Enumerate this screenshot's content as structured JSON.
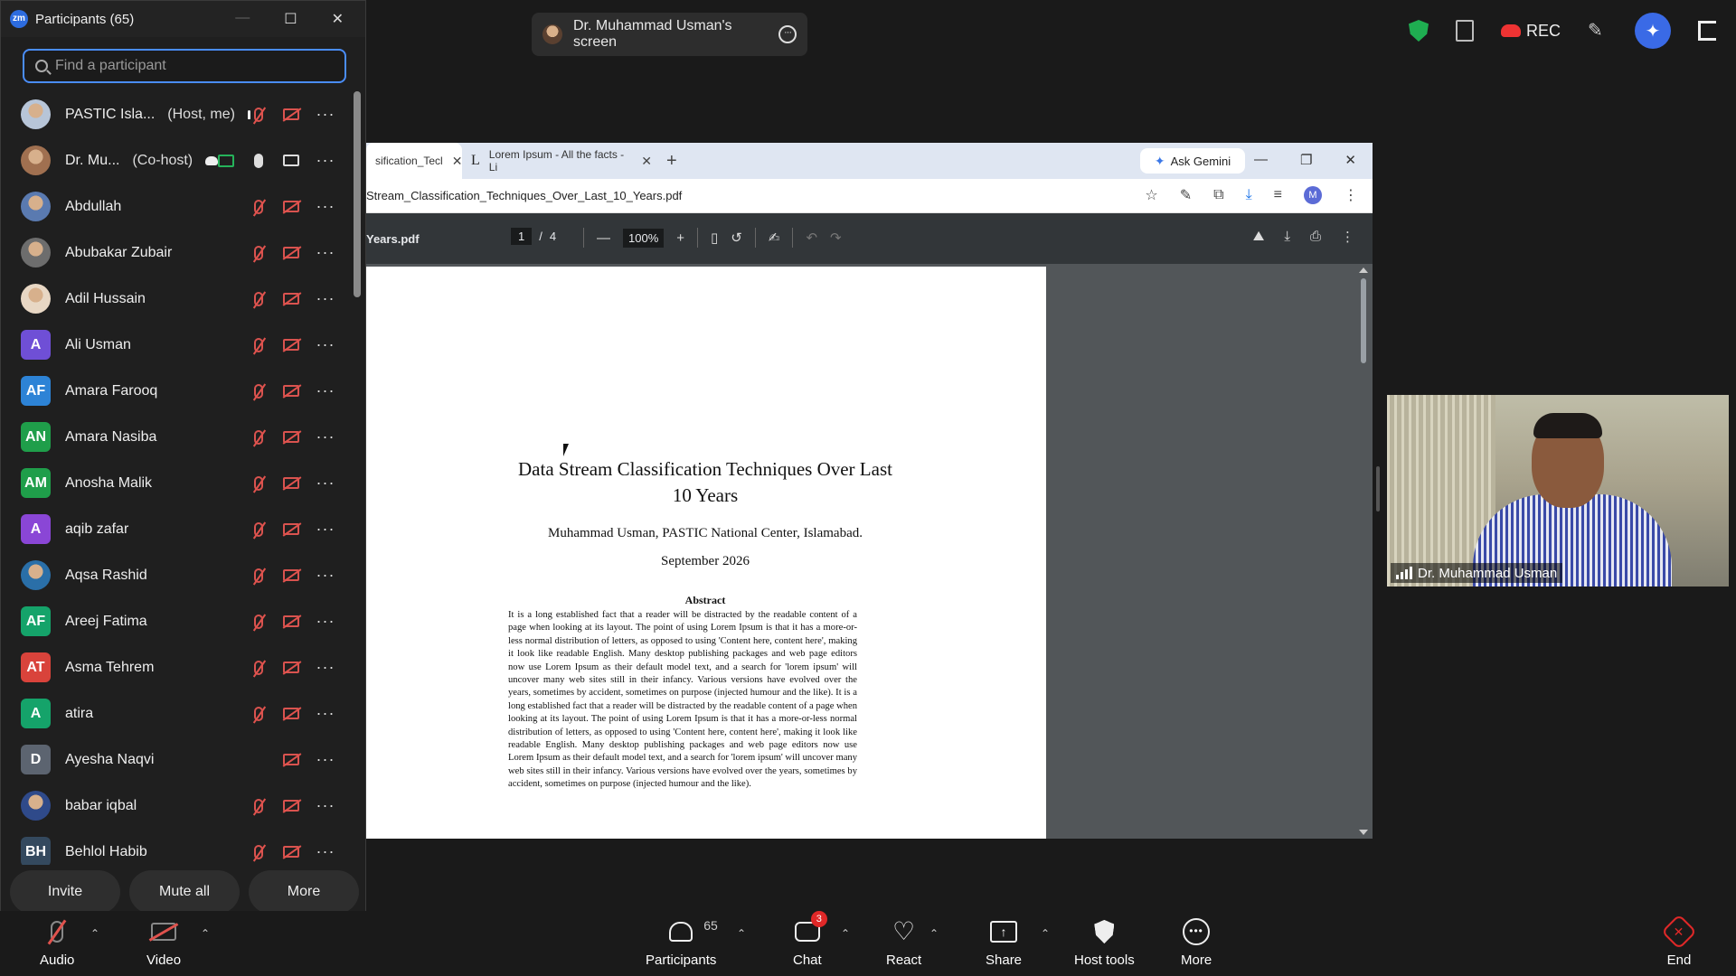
{
  "top_bar": {
    "screen_share_label": "Dr. Muhammad Usman's screen",
    "rec_label": "REC",
    "colors": {
      "security": "#1fae51",
      "rec": "#e33333",
      "ai": "#3a6ae6"
    }
  },
  "participants_panel": {
    "title": "Participants (65)",
    "search_placeholder": "Find a participant",
    "participants": [
      {
        "name": "PASTIC Isla...",
        "tag": "(Host, me)",
        "avatar_type": "photo",
        "avatar_color": "#b7c5d8",
        "initials": "",
        "mic": "off",
        "video": "off",
        "cloud": true,
        "share": false
      },
      {
        "name": "Dr. Mu...",
        "tag": "(Co-host)",
        "avatar_type": "photo",
        "avatar_color": "#a07050",
        "initials": "",
        "mic": "on",
        "video": "on",
        "cloud": true,
        "share": true
      },
      {
        "name": "Abdullah",
        "tag": "",
        "avatar_type": "photo",
        "avatar_color": "#5a7ab0",
        "initials": "",
        "mic": "off",
        "video": "off"
      },
      {
        "name": "Abubakar Zubair",
        "tag": "",
        "avatar_type": "photo",
        "avatar_color": "#6d6d6d",
        "initials": "",
        "mic": "off",
        "video": "off"
      },
      {
        "name": "Adil Hussain",
        "tag": "",
        "avatar_type": "photo",
        "avatar_color": "#e8d7c4",
        "initials": "",
        "mic": "off",
        "video": "off"
      },
      {
        "name": "Ali Usman",
        "tag": "",
        "avatar_type": "initials",
        "avatar_color": "#6f4fd6",
        "initials": "A",
        "mic": "off",
        "video": "off"
      },
      {
        "name": "Amara Farooq",
        "tag": "",
        "avatar_type": "initials",
        "avatar_color": "#2d83d6",
        "initials": "AF",
        "mic": "off",
        "video": "off"
      },
      {
        "name": "Amara Nasiba",
        "tag": "",
        "avatar_type": "initials",
        "avatar_color": "#1f9e4a",
        "initials": "AN",
        "mic": "off",
        "video": "off"
      },
      {
        "name": "Anosha Malik",
        "tag": "",
        "avatar_type": "initials",
        "avatar_color": "#1f9e4a",
        "initials": "AM",
        "mic": "off",
        "video": "off"
      },
      {
        "name": "aqib zafar",
        "tag": "",
        "avatar_type": "initials",
        "avatar_color": "#8a46d6",
        "initials": "A",
        "mic": "off",
        "video": "off"
      },
      {
        "name": "Aqsa Rashid",
        "tag": "",
        "avatar_type": "photo",
        "avatar_color": "#2a6fa8",
        "initials": "",
        "mic": "off",
        "video": "off"
      },
      {
        "name": "Areej Fatima",
        "tag": "",
        "avatar_type": "initials",
        "avatar_color": "#15a36a",
        "initials": "AF",
        "mic": "off",
        "video": "off"
      },
      {
        "name": "Asma Tehrem",
        "tag": "",
        "avatar_type": "initials",
        "avatar_color": "#d9433b",
        "initials": "AT",
        "mic": "off",
        "video": "off"
      },
      {
        "name": "atira",
        "tag": "",
        "avatar_type": "initials",
        "avatar_color": "#15a36a",
        "initials": "A",
        "mic": "off",
        "video": "off"
      },
      {
        "name": "Ayesha Naqvi",
        "tag": "",
        "avatar_type": "initials",
        "avatar_color": "#5c6470",
        "initials": "D",
        "mic": "none",
        "video": "off"
      },
      {
        "name": "babar iqbal",
        "tag": "",
        "avatar_type": "photo",
        "avatar_color": "#2f4a8a",
        "initials": "",
        "mic": "off",
        "video": "off"
      },
      {
        "name": "Behlol Habib",
        "tag": "",
        "avatar_type": "initials",
        "avatar_color": "#34495e",
        "initials": "BH",
        "mic": "off",
        "video": "off"
      }
    ],
    "footer": {
      "invite": "Invite",
      "mute_all": "Mute all",
      "more": "More"
    }
  },
  "browser": {
    "tabs": [
      {
        "title": "sification_Tecl",
        "active": true
      },
      {
        "title": "Lorem Ipsum - All the facts - Li",
        "active": false
      }
    ],
    "ask_gemini": "Ask Gemini",
    "address": "Stream_Classification_Techniques_Over_Last_10_Years.pdf",
    "profile_initial": "M",
    "pdf_toolbar": {
      "filename": "Years.pdf",
      "page_current": "1",
      "page_sep": "/",
      "page_total": "4",
      "zoom": "100%"
    },
    "document": {
      "title_line1": "Data Stream Classification Techniques Over Last",
      "title_line2": "10 Years",
      "author": "Muhammad Usman, PASTIC National Center, Islamabad.",
      "date": "September 2026",
      "abstract_heading": "Abstract",
      "abstract_text": "It is a long established fact that a reader will be distracted by the readable content of a page when looking at its layout. The point of using Lorem Ipsum is that it has a more-or-less normal distribution of letters, as opposed to using 'Content here, content here', making it look like readable English. Many desktop publishing packages and web page editors now use Lorem Ipsum as their default model text, and a search for 'lorem ipsum' will uncover many web sites still in their infancy. Various versions have evolved over the years, sometimes by accident, sometimes on purpose (injected humour and the like). It is a long established fact that a reader will be distracted by the readable content of a page when looking at its layout. The point of using Lorem Ipsum is that it has a more-or-less normal distribution of letters, as opposed to using 'Content here, content here', making it look like readable English. Many desktop publishing packages and web page editors now use Lorem Ipsum as their default model text, and a search for 'lorem ipsum' will uncover many web sites still in their infancy. Various versions have evolved over the years, sometimes by accident, sometimes on purpose (injected humour and the like)."
    }
  },
  "video_tile": {
    "name": "Dr. Muhammad Usman"
  },
  "toolbar": {
    "audio": "Audio",
    "video": "Video",
    "participants": "Participants",
    "participants_count": "65",
    "chat": "Chat",
    "chat_badge": "3",
    "react": "React",
    "share": "Share",
    "host_tools": "Host tools",
    "more": "More",
    "end": "End",
    "end_color": "#e02828"
  }
}
